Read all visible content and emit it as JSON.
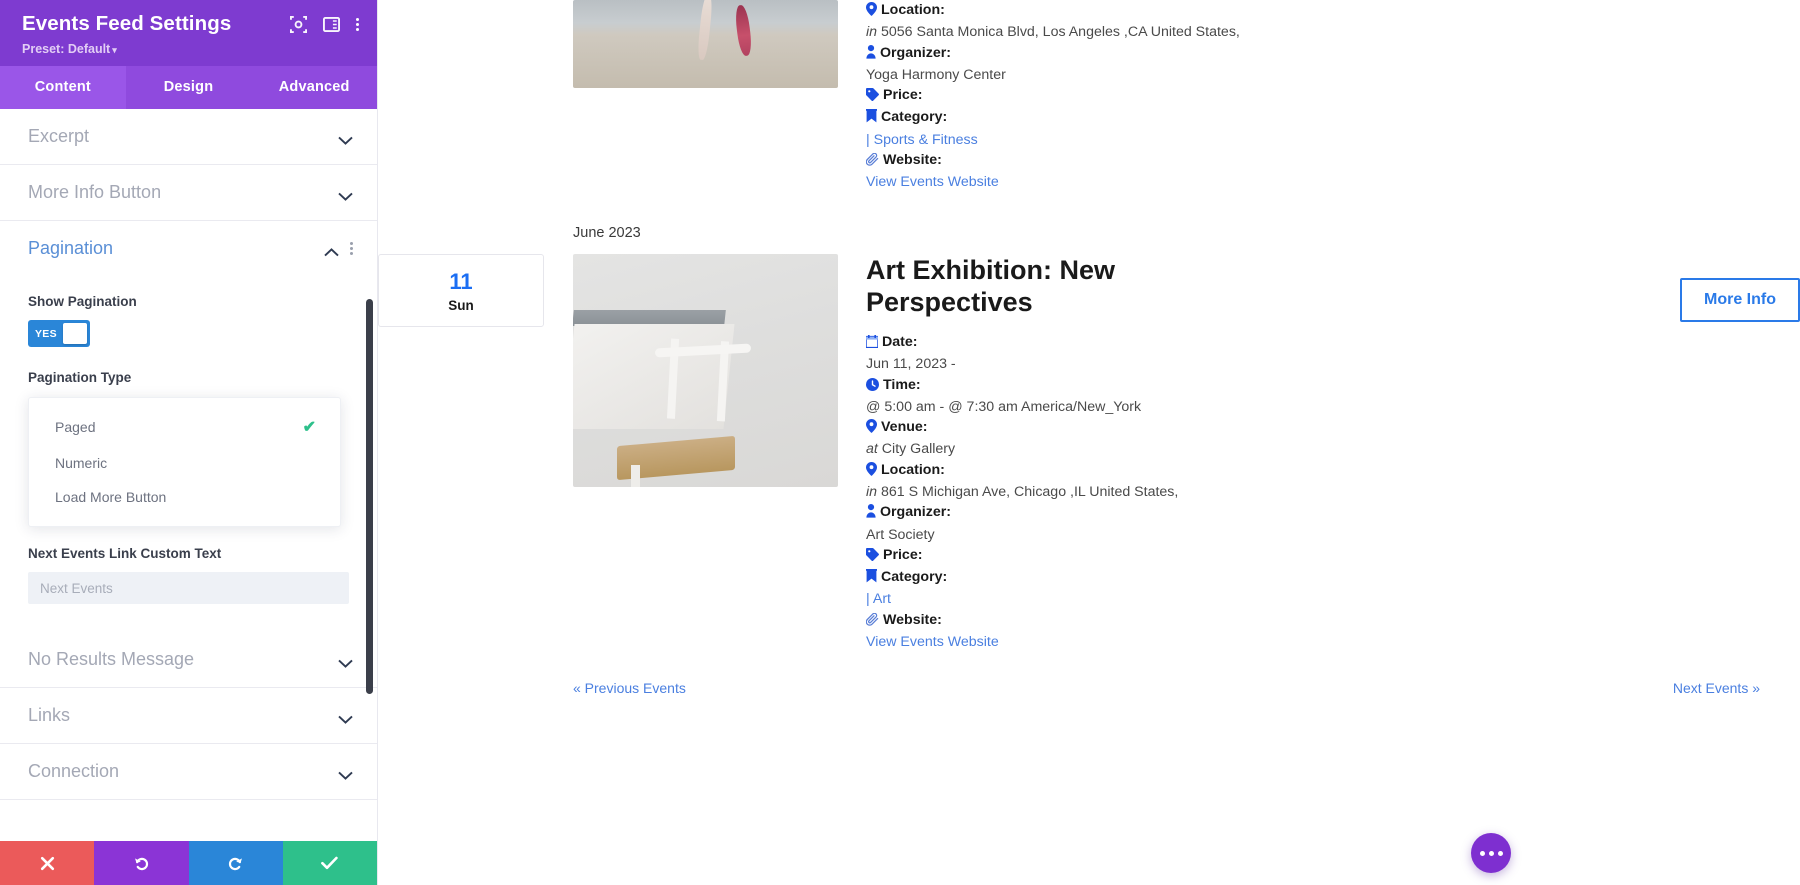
{
  "sidebar": {
    "title": "Events Feed Settings",
    "preset_label": "Preset: Default",
    "preset_caret": "▾",
    "tabs": [
      {
        "label": "Content",
        "active": true
      },
      {
        "label": "Design",
        "active": false
      },
      {
        "label": "Advanced",
        "active": false
      }
    ],
    "sections": [
      {
        "label": "Excerpt",
        "open": false
      },
      {
        "label": "More Info Button",
        "open": false
      },
      {
        "label": "Pagination",
        "open": true
      },
      {
        "label": "No Results Message",
        "open": false
      },
      {
        "label": "Links",
        "open": false
      },
      {
        "label": "Connection",
        "open": false
      }
    ],
    "pagination_panel": {
      "show_pagination_label": "Show Pagination",
      "toggle_value": "YES",
      "pagination_type_label": "Pagination Type",
      "options": [
        {
          "label": "Paged",
          "selected": true
        },
        {
          "label": "Numeric",
          "selected": false
        },
        {
          "label": "Load More Button",
          "selected": false
        }
      ],
      "check_glyph": "✔",
      "next_link_label": "Next Events Link Custom Text",
      "next_link_value": "",
      "next_link_placeholder": "Next Events"
    },
    "footer_buttons": [
      {
        "name": "cancel-button",
        "glyph": "✖"
      },
      {
        "name": "undo-button",
        "glyph": "↺"
      },
      {
        "name": "redo-button",
        "glyph": "↻"
      },
      {
        "name": "save-button",
        "glyph": "✔"
      }
    ],
    "colors": {
      "header": "#7e3bd0",
      "tabs": "#8f4ade",
      "tab_active": "#9a56e8",
      "toggle_on": "#2a86d8",
      "check": "#2ec08b"
    }
  },
  "feed": {
    "events": [
      {
        "id": "yoga-event",
        "show_datebox": false,
        "title": "",
        "meta": {
          "location_label": "Location:",
          "location_prefix": "in",
          "location_value": "5056 Santa Monica Blvd, Los Angeles ,CA United States,",
          "organizer_label": "Organizer:",
          "organizer_value": "Yoga Harmony Center",
          "price_label": "Price:",
          "price_value": "",
          "category_label": "Category:",
          "category_sep": "|",
          "category_value": "Sports & Fitness",
          "website_label": "Website:",
          "website_value": "View Events Website"
        }
      },
      {
        "id": "art-exhibition-event",
        "show_datebox": true,
        "month_heading": "June 2023",
        "date_number": "11",
        "date_day": "Sun",
        "title": "Art Exhibition: New Perspectives",
        "more_info_label": "More Info",
        "meta": {
          "date_label": "Date:",
          "date_value": "Jun 11, 2023 -",
          "time_label": "Time:",
          "time_value": "@ 5:00 am - @ 7:30 am America/New_York",
          "venue_label": "Venue:",
          "venue_prefix": "at",
          "venue_value": "City Gallery",
          "location_label": "Location:",
          "location_prefix": "in",
          "location_value": "861 S Michigan Ave, Chicago ,IL United States,",
          "organizer_label": "Organizer:",
          "organizer_value": "Art Society",
          "price_label": "Price:",
          "price_value": "",
          "category_label": "Category:",
          "category_sep": "|",
          "category_value": "Art",
          "website_label": "Website:",
          "website_value": "View Events Website"
        }
      }
    ],
    "pager": {
      "prev_label": "« Previous Events",
      "next_label": "Next Events »"
    }
  }
}
